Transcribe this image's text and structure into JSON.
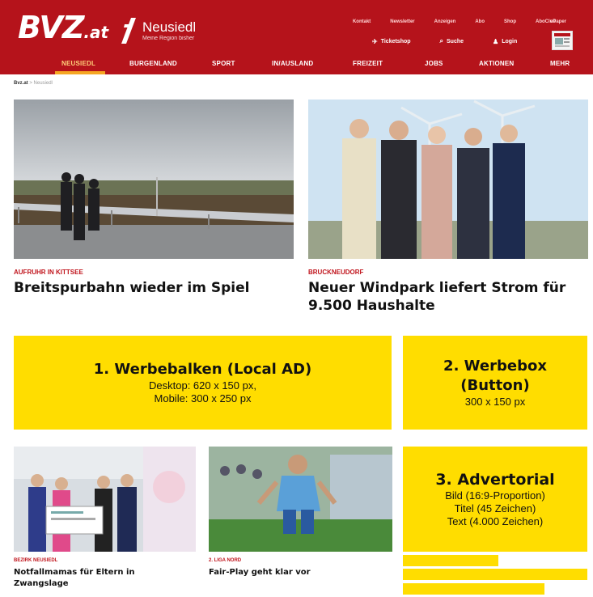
{
  "header": {
    "logo_main": "BVZ",
    "logo_suffix": ".at",
    "region_name": "Neusiedl",
    "region_sub": "Meine Region bisher",
    "top_links": [
      "Kontakt",
      "Newsletter",
      "Anzeigen",
      "Abo",
      "Shop",
      "AboClub",
      "ePaper"
    ],
    "tools": [
      {
        "icon": "ticket-icon",
        "label": "Ticketshop"
      },
      {
        "icon": "search-icon",
        "label": "Suche"
      },
      {
        "icon": "user-icon",
        "label": "Login"
      }
    ],
    "nav": [
      "NEUSIEDL",
      "BURGENLAND",
      "SPORT",
      "IN/AUSLAND",
      "FREIZEIT",
      "JOBS",
      "AKTIONEN",
      "MEHR"
    ],
    "active_nav": "NEUSIEDL"
  },
  "breadcrumb": {
    "home": "Bvz.at",
    "sep": ">",
    "current": "Neusiedl"
  },
  "articles": [
    {
      "kicker": "Aufruhr in Kittsee",
      "headline": "Breitspurbahn wieder im Spiel"
    },
    {
      "kicker": "Bruckneudorf",
      "headline": "Neuer Windpark liefert Strom für 9.500 Haushalte"
    },
    {
      "kicker": "Bezirk Neusiedl",
      "headline": "Notfallmamas für Eltern in Zwangslage"
    },
    {
      "kicker": "2. Liga Nord",
      "headline": "Fair-Play geht klar vor"
    }
  ],
  "ads": {
    "ad1": {
      "title": "1. Werbebalken (Local AD)",
      "line1": "Desktop: 620 x 150 px,",
      "line2": "Mobile: 300 x 250 px"
    },
    "ad2": {
      "title1": "2. Werbebox",
      "title2": "(Button)",
      "line1": "300 x 150 px"
    },
    "ad3": {
      "title": "3. Advertorial",
      "line1": "Bild (16:9-Proportion)",
      "line2": "Titel (45 Zeichen)",
      "line3": "Text (4.000 Zeichen)"
    }
  },
  "colors": {
    "brand_red": "#b5131b",
    "accent_orange": "#f5a623",
    "ad_yellow": "#ffdd00",
    "kicker_red": "#c0141c"
  }
}
